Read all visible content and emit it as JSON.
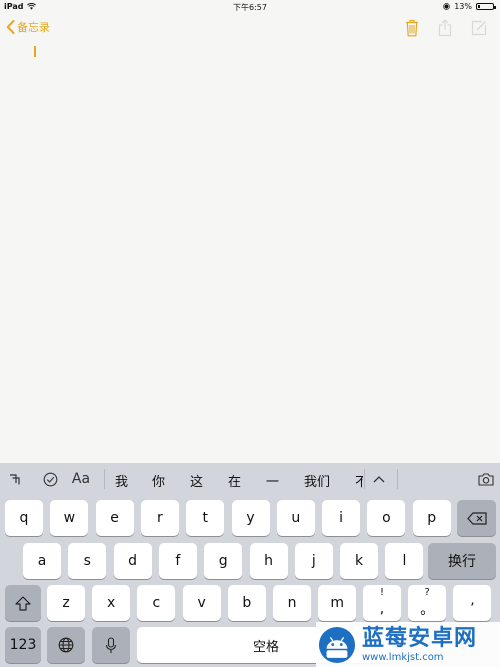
{
  "status_bar": {
    "device": "iPad",
    "time": "下午6:57",
    "battery_percent": "13%",
    "battery_level": 0.13
  },
  "nav_bar": {
    "back_label": "备忘录"
  },
  "suggestions": {
    "words": [
      "我",
      "你",
      "这",
      "在",
      "一",
      "我们",
      "不"
    ],
    "tools": [
      "Aa"
    ]
  },
  "keyboard": {
    "row1": [
      "q",
      "w",
      "e",
      "r",
      "t",
      "y",
      "u",
      "i",
      "o",
      "p"
    ],
    "row2": [
      "a",
      "s",
      "d",
      "f",
      "g",
      "h",
      "j",
      "k",
      "l"
    ],
    "row2_return": "换行",
    "row3": [
      "z",
      "x",
      "c",
      "v",
      "b",
      "n",
      "m"
    ],
    "row3_punct": [
      {
        "sub": "!",
        "main": ","
      },
      {
        "sub": "?",
        "main": "。"
      },
      {
        "sub": "",
        "main": "’"
      }
    ],
    "numbers_key": "123",
    "space": "空格"
  },
  "watermark": {
    "brand": "蓝莓安卓网",
    "url": "www.lmkjst.com"
  },
  "colors": {
    "accent": "#e5a823",
    "watermark_blue": "#1d6fc2"
  }
}
